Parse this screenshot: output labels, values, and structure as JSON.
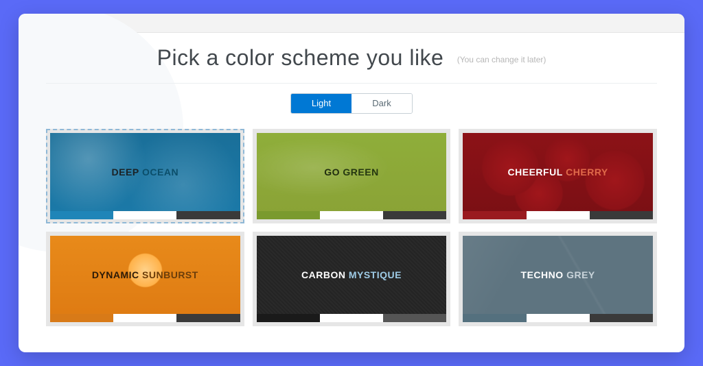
{
  "heading": {
    "title": "Pick a color scheme you like",
    "subtitle": "(You can change it later)"
  },
  "toggle": {
    "light": "Light",
    "dark": "Dark",
    "active": "light"
  },
  "schemes": [
    {
      "id": "deep-ocean",
      "word1": "DEEP",
      "word2": "OCEAN",
      "selected": true,
      "bg_class": "bg-ocean",
      "label_class": "lbl-dark",
      "accent_class": "accent",
      "swatches": [
        "#1f85b8",
        "#ffffff",
        "#3a3a3a"
      ]
    },
    {
      "id": "go-green",
      "word1": "GO",
      "word2": "GREEN",
      "selected": false,
      "bg_class": "bg-green",
      "label_class": "lbl-ongreen",
      "accent_class": "accent",
      "swatches": [
        "#7a9a2e",
        "#ffffff",
        "#3a3a3a"
      ]
    },
    {
      "id": "cheerful-cherry",
      "word1": "CHEERFUL",
      "word2": "CHERRY",
      "selected": false,
      "bg_class": "bg-cherry",
      "label_class": "lbl-light",
      "accent_class": "accent-cherry",
      "swatches": [
        "#9a1a1f",
        "#ffffff",
        "#3a3a3a"
      ]
    },
    {
      "id": "dynamic-sunburst",
      "word1": "DYNAMIC",
      "word2": "SUNBURST",
      "selected": false,
      "bg_class": "bg-sunburst",
      "label_class": "lbl-onsun",
      "accent_class": "accent",
      "swatches": [
        "#d87a18",
        "#ffffff",
        "#3a3a3a"
      ]
    },
    {
      "id": "carbon-mystique",
      "word1": "CARBON",
      "word2": "MYSTIQUE",
      "selected": false,
      "bg_class": "bg-carbon",
      "label_class": "lbl-light",
      "accent_class": "accent-carbon",
      "swatches": [
        "#1a1a1a",
        "#ffffff",
        "#555555"
      ]
    },
    {
      "id": "techno-grey",
      "word1": "TECHNO",
      "word2": "GREY",
      "selected": false,
      "bg_class": "bg-grey",
      "label_class": "lbl-light",
      "accent_class": "accent-grey",
      "swatches": [
        "#54707e",
        "#ffffff",
        "#3a3a3a"
      ]
    }
  ]
}
